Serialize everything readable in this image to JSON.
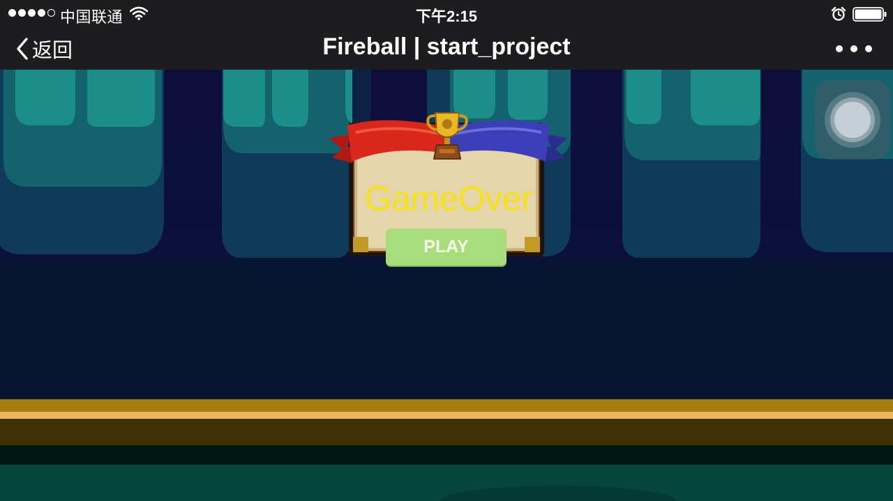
{
  "status_bar": {
    "carrier": "中国联通",
    "time": "下午2:15",
    "signal_bars_filled": 4,
    "signal_bars_total": 5,
    "battery_level": 1.0,
    "icons": [
      "wifi-icon",
      "alarm-icon",
      "battery-icon"
    ]
  },
  "nav_bar": {
    "back_label": "返回",
    "title": "Fireball | start_project",
    "more_icon": "more-dots-icon"
  },
  "game": {
    "gameover_text": "GameOver",
    "play_label": "PLAY",
    "trophy_icon": "trophy-icon"
  },
  "colors": {
    "bar_background": "#1d1d1f",
    "gameover_text": "#f5e21c",
    "play_button": "#a9dc7a",
    "ribbon_red": "#d9271d",
    "ribbon_blue": "#3a3fb8",
    "stalactite_teal": "#1b8e8a",
    "ground_gold": "#a57e0b"
  }
}
